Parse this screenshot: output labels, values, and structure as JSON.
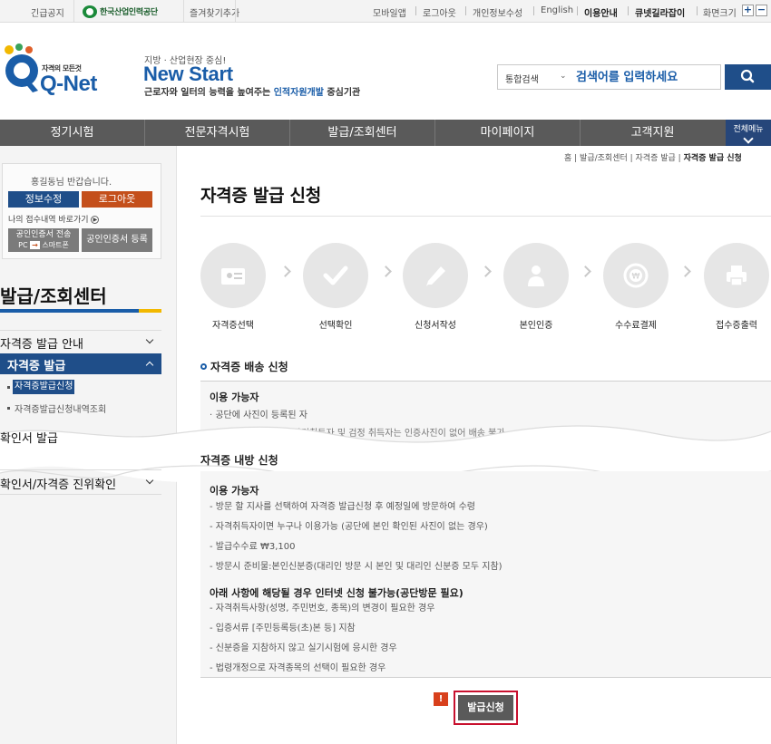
{
  "topbar": {
    "notice": "긴급공지",
    "org_name": "한국산업인력공단",
    "favorites": "즐겨찾기추가",
    "mobile": "모바일앱",
    "logout": "로그아웃",
    "privacy": "개인정보수성",
    "english": "English",
    "usage": "이용안내",
    "shortcut": "큐넷길라잡이",
    "zoom": "화면크기",
    "zoom_in": "+",
    "zoom_out": "−"
  },
  "header": {
    "logo_sub": "자격의 모든것",
    "logo_name": "Q-Net",
    "slogan_small": "지방 · 산업현장 중심!",
    "slogan_big": "New Start",
    "slogan_desc_pre": "근로자와 일터의 능력을 높여주는 ",
    "slogan_desc_hl": "인적자원개발",
    "slogan_desc_post": " 중심기관"
  },
  "search": {
    "scope": "통합검색",
    "placeholder": "검색어를 입력하세요"
  },
  "gnb": {
    "items": [
      "정기시험",
      "전문자격시험",
      "발급/조회센터",
      "마이페이지",
      "고객지원"
    ],
    "all_menu": "전체메뉴"
  },
  "login": {
    "greeting": "홍길동님 반갑습니다.",
    "info_btn": "정보수정",
    "logout_btn": "로그아웃",
    "my_link": "나의 접수내역 바로가기",
    "cert_transfer": "공인인증서 전송",
    "cert_transfer_sub_a": "PC",
    "cert_transfer_sub_b": "스마트폰",
    "cert_register": "공인인증서 등록"
  },
  "sidebar": {
    "title": "발급/조회센터",
    "items": [
      "자격증 발급 안내",
      "자격증 발급",
      "확인서 발급",
      "확인서/자격증 진위확인"
    ],
    "sub_items": [
      "자격증발급신청",
      "자격증발급신청내역조회"
    ]
  },
  "breadcrumb": {
    "home": "홈",
    "l1": "발급/조회센터",
    "l2": "자격증 발급",
    "current": "자격증 발급 신청"
  },
  "page": {
    "title": "자격증 발급 신청"
  },
  "steps": [
    "자격증선택",
    "선택확인",
    "신청서작성",
    "본인인증",
    "수수료결제",
    "접수증출력"
  ],
  "delivery": {
    "title": "자격증 배송 신청",
    "head": "이용 가능자",
    "lines": [
      "· 공단에 사진이 등록된 자",
      "※ 2005년 9월 이전 자격취득자 및 검정 취득자는 인증사진이 없어 배송 불가."
    ]
  },
  "visit": {
    "title": "자격증 내방 신청",
    "head1": "이용 가능자",
    "lines1": [
      "- 방문 할 지사를 선택하여 자격증 발급신청 후 예정일에 방문하여 수령",
      "- 자격취득자이면 누구나 이용가능 (공단에 본인 확인된 사진이 없는 경우)",
      "- 발급수수료 ₩3,100",
      "- 방문시 준비물:본인신분증(대리인 방문 시 본인 및 대리인 신분증 모두 지참)"
    ],
    "head2": "아래 사항에 해당될 경우 인터넷 신청 불가능(공단방문 필요)",
    "lines2": [
      "- 자격취득사항(성명, 주민번호, 종목)의 변경이 필요한 경우",
      "- 입증서류 [주민등록등(초)본 등] 지참",
      "- 신분증을 지참하지 않고 실기시험에 응시한 경우",
      "- 법령개정으로 자격종목의 선택이 필요한 경우"
    ]
  },
  "actions": {
    "alert_mark": "!",
    "apply": "발급신청"
  }
}
